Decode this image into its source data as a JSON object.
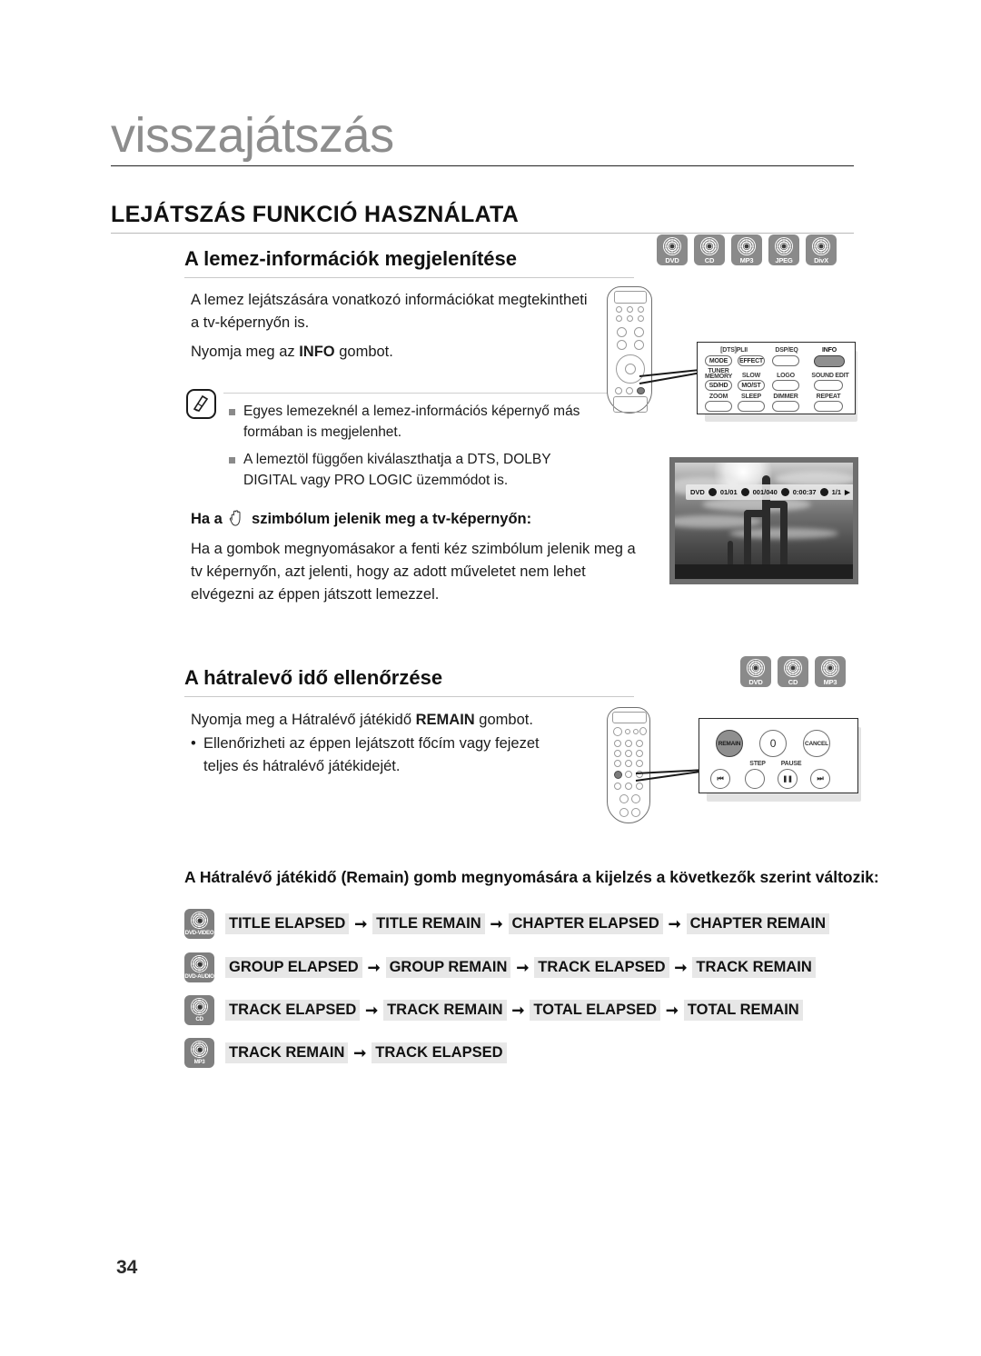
{
  "chapter": {
    "title": "visszajátszás"
  },
  "section": {
    "title": "LEJÁTSZÁS FUNKCIÓ HASZNÁLATA"
  },
  "subsection1": {
    "title": "A lemez-információk megjelenítése",
    "badges": [
      {
        "label": "DVD",
        "name": "disc-badge-dvd"
      },
      {
        "label": "CD",
        "name": "disc-badge-cd"
      },
      {
        "label": "MP3",
        "name": "disc-badge-mp3"
      },
      {
        "label": "JPEG",
        "name": "disc-badge-jpeg"
      },
      {
        "label": "DivX",
        "name": "disc-badge-divx"
      }
    ],
    "paragraph1": "A lemez lejátszására vonatkozó információkat megtekintheti a tv-képernyőn is.",
    "paragraph2_before": "Nyomja meg az ",
    "paragraph2_bold": "INFO",
    "paragraph2_after": " gombot.",
    "notes": [
      "Egyes lemezeknél a lemez-információs képernyő más formában is megjelenhet.",
      "A lemeztöl függően kiválaszthatja a DTS, DOLBY DIGITAL vagy PRO LOGIC üzemmódot is."
    ],
    "hand_heading_before": "Ha a",
    "hand_heading_after": "szimbólum jelenik meg a tv-képernyőn:",
    "hand_paragraph": "Ha a gombok megnyomásakor a fenti kéz szimbólum jelenik meg a tv képernyőn, azt jelenti, hogy az adott műveletet nem lehet elvégezni az éppen játszott lemezzel."
  },
  "remote_callout_top": {
    "rows": [
      {
        "labels": [
          "",
          "[DTS]PLII",
          "DSP/EQ",
          "INFO"
        ],
        "buttons": [
          "MODE",
          "EFFECT",
          "",
          ""
        ]
      },
      {
        "labels": [
          "TUNER MEMORY",
          "SLOW",
          "LOGO",
          "SOUND EDIT"
        ],
        "buttons": [
          "SD/HD",
          "MO/ST",
          "",
          ""
        ]
      },
      {
        "labels": [
          "ZOOM",
          "SLEEP",
          "DIMMER",
          "REPEAT"
        ],
        "buttons": [
          "",
          "",
          "",
          ""
        ]
      }
    ],
    "label_dtspl": "[DTS]PLII",
    "label_dspeq": "DSP/EQ",
    "label_info": "INFO",
    "label_tuner": "TUNER",
    "label_memory": "MEMORY",
    "label_slow": "SLOW",
    "label_logo": "LOGO",
    "label_sound_edit": "SOUND EDIT",
    "label_zoom": "ZOOM",
    "label_sleep": "SLEEP",
    "label_dimmer": "DIMMER",
    "label_repeat": "REPEAT",
    "btn_mode": "MODE",
    "btn_effect": "EFFECT",
    "btn_sdhd": "SD/HD",
    "btn_most": "MO/ST"
  },
  "tv_osd": {
    "disc_type": "DVD",
    "title": "01/01",
    "chapter": "001/040",
    "time": "0:00:37",
    "audio": "1/1",
    "play_glyph": "▶"
  },
  "subsection2": {
    "title": "A hátralevő idő ellenőrzése",
    "badges": [
      {
        "label": "DVD",
        "name": "disc-badge-dvd"
      },
      {
        "label": "CD",
        "name": "disc-badge-cd"
      },
      {
        "label": "MP3",
        "name": "disc-badge-mp3"
      }
    ],
    "paragraph1_before": "Nyomja meg a Hátralévő játékidő ",
    "paragraph1_bold": "REMAIN",
    "paragraph1_after": " gombot.",
    "bullet1": "Ellenőrizheti az éppen lejátszott főcím vagy fejezet teljes és hátralévő játékidejét."
  },
  "remote_callout_bottom": {
    "btn_remain": "REMAIN",
    "btn_zero": "0",
    "btn_cancel": "CANCEL",
    "label_step": "STEP",
    "label_pause": "PAUSE",
    "glyph_prev": "⏮",
    "glyph_pause": "❚❚",
    "glyph_next": "⏭"
  },
  "sequence": {
    "intro": "A Hátralévő játékidő (Remain) gomb megnyomására a kijelzés a következők szerint változik:",
    "arrow": "➞",
    "rows": [
      {
        "badge": "DVD-VIDEO",
        "terms": [
          "TITLE ELAPSED",
          "TITLE REMAIN",
          "CHAPTER ELAPSED",
          "CHAPTER REMAIN"
        ]
      },
      {
        "badge": "DVD-AUDIO",
        "terms": [
          "GROUP ELAPSED",
          "GROUP REMAIN",
          "TRACK ELAPSED",
          "TRACK REMAIN"
        ]
      },
      {
        "badge": "CD",
        "terms": [
          "TRACK ELAPSED",
          "TRACK REMAIN",
          "TOTAL ELAPSED",
          "TOTAL REMAIN"
        ]
      },
      {
        "badge": "MP3",
        "terms": [
          "TRACK REMAIN",
          "TRACK ELAPSED"
        ]
      }
    ]
  },
  "footer": {
    "page_number": "34"
  }
}
